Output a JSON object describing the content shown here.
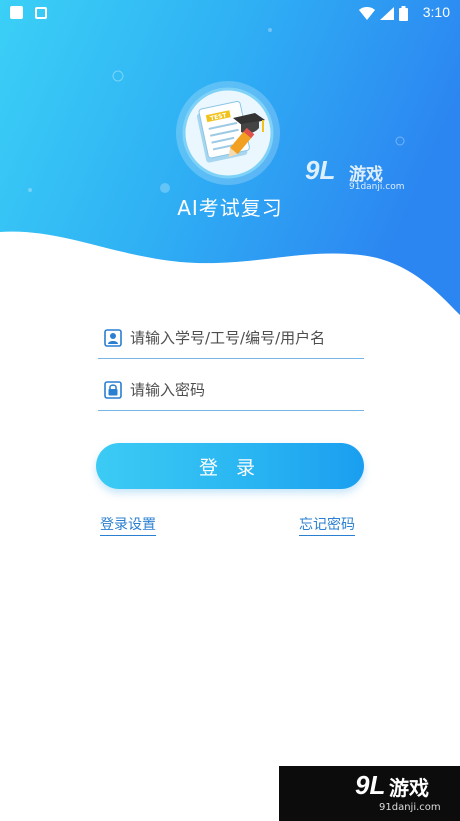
{
  "status_bar": {
    "time": "3:10"
  },
  "app": {
    "title": "AI考试复习",
    "logo_badge_text": "TEST"
  },
  "form": {
    "username_placeholder": "请输入学号/工号/编号/用户名",
    "password_placeholder": "请输入密码",
    "login_label": "登 录",
    "settings_link": "登录设置",
    "forgot_link": "忘记密码"
  },
  "watermark": {
    "logo": "9L",
    "name": "游戏",
    "url": "91danji.com"
  },
  "colors": {
    "hero_start": "#35c6f5",
    "hero_end": "#2f8ef2",
    "accent": "#2a7fd0"
  }
}
